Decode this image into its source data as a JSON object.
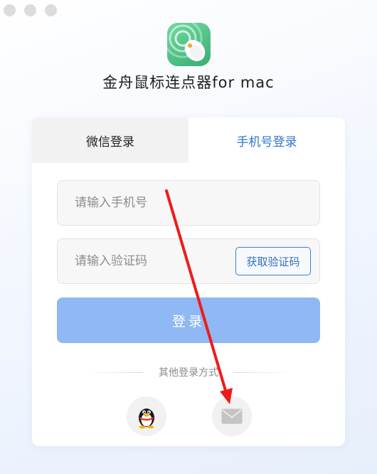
{
  "window": {
    "title": "金舟鼠标连点器for mac"
  },
  "tabs": [
    {
      "label": "微信登录",
      "active": false
    },
    {
      "label": "手机号登录",
      "active": true
    }
  ],
  "form": {
    "phone_placeholder": "请输入手机号",
    "code_placeholder": "请输入验证码",
    "get_code_label": "获取验证码",
    "login_label": "登录"
  },
  "other_login": {
    "label": "其他登录方式",
    "methods": [
      {
        "icon": "qq-penguin-icon"
      },
      {
        "icon": "mail-icon"
      }
    ]
  },
  "colors": {
    "accent": "#2f76c9",
    "login_button": "#8fb8f5",
    "app_icon": "#4cbf84",
    "annotation_arrow": "#ee1b1b"
  }
}
